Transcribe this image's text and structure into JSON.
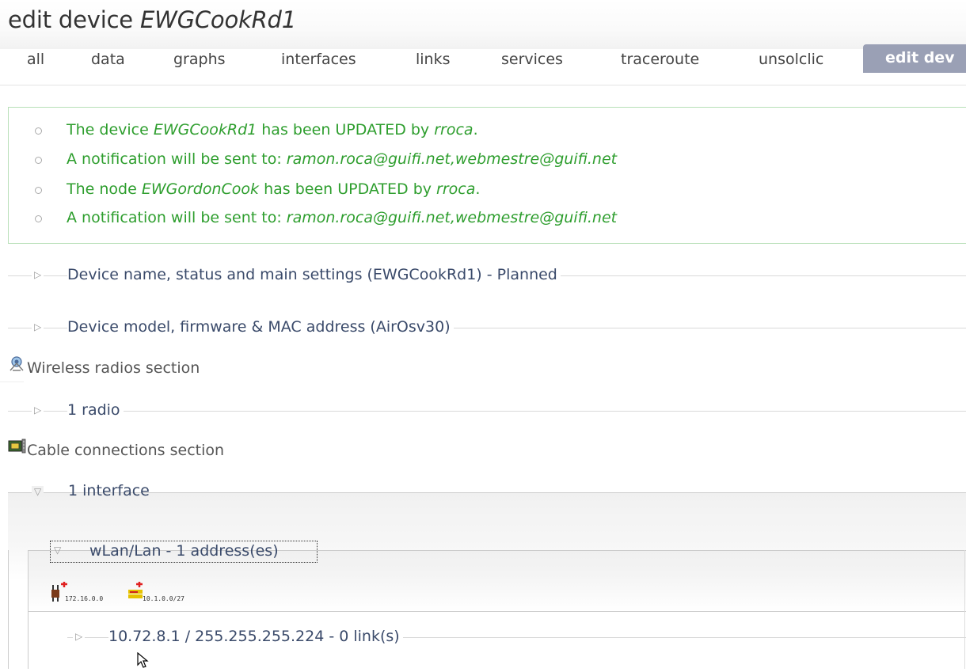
{
  "page": {
    "title_prefix": "edit device",
    "device_name": "EWGCookRd1"
  },
  "tabs": [
    {
      "label": "all"
    },
    {
      "label": "data"
    },
    {
      "label": "graphs"
    },
    {
      "label": "interfaces"
    },
    {
      "label": "links"
    },
    {
      "label": "services"
    },
    {
      "label": "traceroute"
    },
    {
      "label": "unsolclic"
    },
    {
      "label": "edit dev",
      "active": true
    }
  ],
  "messages": [
    {
      "pre": "The device ",
      "em": "EWGCookRd1",
      "mid": " has been UPDATED by ",
      "em2": "rroca",
      "post": "."
    },
    {
      "pre": "A notification will be sent to: ",
      "em": "ramon.roca@guifi.net,webmestre@guifi.net"
    },
    {
      "pre": "The node ",
      "em": "EWGordonCook",
      "mid": " has been UPDATED by ",
      "em2": "rroca",
      "post": "."
    },
    {
      "pre": "A notification will be sent to: ",
      "em": "ramon.roca@guifi.net,webmestre@guifi.net"
    }
  ],
  "fieldsets": {
    "main_settings": "Device name, status and main settings (EWGCookRd1) - Planned",
    "model_firmware": "Device model, firmware & MAC address (AirOsv30)",
    "radios": "1 radio",
    "interfaces": "1 interface",
    "wlan": "wLan/Lan - 1 address(es)",
    "address": "10.72.8.1 / 255.255.255.224 - 0 link(s)"
  },
  "sections": {
    "wireless": "Wireless radios section",
    "cable": "Cable connections section"
  },
  "icon_labels": {
    "add_ip": "172.16.0.0",
    "add_subnet": "10.1.0.0/27"
  },
  "colors": {
    "message_green": "#2e9e2e",
    "legend_blue": "#3a4a6a",
    "active_tab": "#9aa0b5"
  }
}
